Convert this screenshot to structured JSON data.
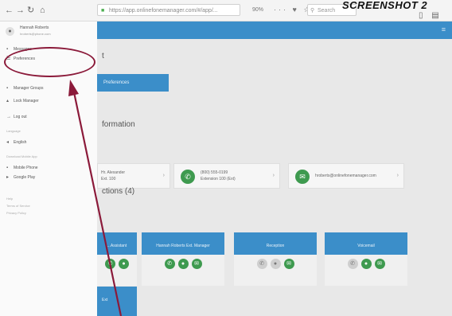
{
  "browser": {
    "back_icon": "back-arrow-icon",
    "forward_icon": "forward-arrow-icon",
    "reload_icon": "reload-icon",
    "home_icon": "home-icon",
    "url": "https://app.onlinefonemanager.com/#/app/...",
    "search_placeholder": "Search",
    "zoom": "90%"
  },
  "caption": "SCREENSHOT 2",
  "sidebar": {
    "account_name": "Hannah Roberts",
    "account_email": "hroberts@phone.com",
    "items": [
      {
        "icon": "messages-icon",
        "label": "Messages"
      },
      {
        "icon": "preferences-icon",
        "label": "Preferences"
      },
      {
        "icon": "manager-groups-icon",
        "label": "Manager Groups"
      },
      {
        "icon": "lock-manager-icon",
        "label": "Lock Manager"
      },
      {
        "icon": "log-out-icon",
        "label": "Log out"
      },
      {
        "icon": "language-icon",
        "label": "English"
      },
      {
        "icon": "mobile-icon",
        "label": "Mobile Phone"
      },
      {
        "icon": "google-play-icon",
        "label": "Google Play"
      }
    ],
    "headers": [
      "Language",
      "Download Mobile App"
    ],
    "links": [
      "Help",
      "Terms of Service",
      "Privacy Policy"
    ]
  },
  "main": {
    "section_1": "t",
    "button_label": "Preferences",
    "section_2": "formation",
    "contacts": [
      {
        "icon": "person-icon",
        "line1": "Hr. Alexander",
        "line2": "Ext. 100"
      },
      {
        "icon": "phone-icon",
        "line1": "(800) 555-0199",
        "line2": "Extension 100 (Ext)"
      },
      {
        "icon": "email-icon",
        "line1": "hroberts@onlinefonemanager.com",
        "line2": ""
      }
    ],
    "section_3": "ctions (4)",
    "tiles": [
      {
        "label": "...Assistant"
      },
      {
        "label": "Hannah Roberts Ext. Manager"
      },
      {
        "label": "Reception"
      },
      {
        "label": "Voicemail"
      }
    ],
    "small_tile_label": "Ext"
  },
  "colors": {
    "accent_blue": "#3b8ec9",
    "green": "#3e9a4f",
    "annotation": "#8b1a3a"
  }
}
